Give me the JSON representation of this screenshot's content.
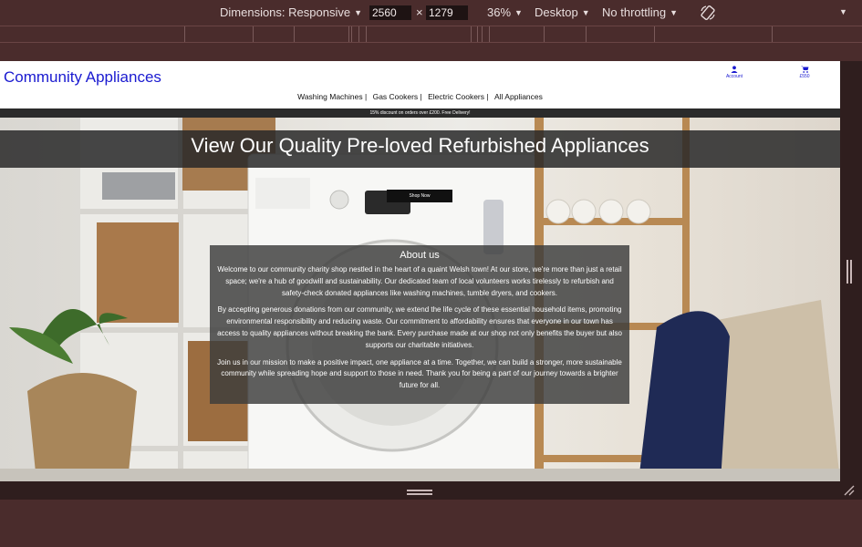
{
  "devtools": {
    "dimensions_label": "Dimensions: Responsive",
    "width": "2560",
    "height": "1279",
    "times": "×",
    "zoom": "36%",
    "device": "Desktop",
    "throttling": "No throttling"
  },
  "site": {
    "logo": "Community Appliances",
    "account_label": "Account",
    "cart_label": "£550",
    "nav": [
      "Washing Machines |",
      "Gas Cookers |",
      "Electric Cookers |",
      "All Appliances"
    ],
    "promo": "15% discount on orders over £200. Free Delivery!",
    "hero_title": "View Our Quality Pre-loved Refurbished Appliances",
    "shop_now": "Shop Now",
    "about": {
      "heading": "About us",
      "paragraphs": [
        "Welcome to our community charity shop nestled in the heart of a quaint Welsh town! At our store, we're more than just a retail space; we're a hub of goodwill and sustainability. Our dedicated team of local volunteers works tirelessly to refurbish and safety-check donated appliances like washing machines, tumble dryers, and cookers.",
        "By accepting generous donations from our community, we extend the life cycle of these essential household items, promoting environmental responsibility and reducing waste. Our commitment to affordability ensures that everyone in our town has access to quality appliances without breaking the bank. Every purchase made at our shop not only benefits the buyer but also supports our charitable initiatives.",
        "Join us in our mission to make a positive impact, one appliance at a time. Together, we can build a stronger, more sustainable community while spreading hope and support to those in need. Thank you for being a part of our journey towards a brighter future for all."
      ]
    }
  }
}
